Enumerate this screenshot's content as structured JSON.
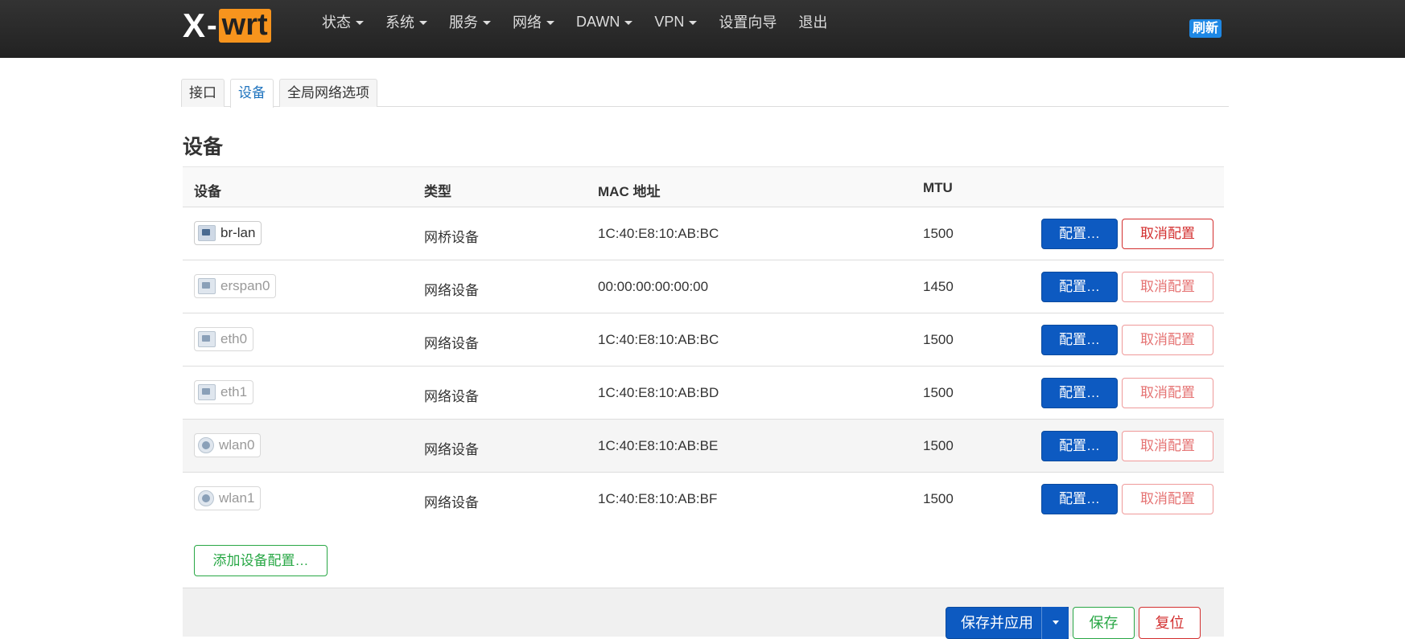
{
  "brand": {
    "x": "X",
    "dash": "-",
    "wrt": "wrt"
  },
  "nav": [
    {
      "label": "状态",
      "dropdown": true
    },
    {
      "label": "系统",
      "dropdown": true
    },
    {
      "label": "服务",
      "dropdown": true
    },
    {
      "label": "网络",
      "dropdown": true
    },
    {
      "label": "DAWN",
      "dropdown": true
    },
    {
      "label": "VPN",
      "dropdown": true
    },
    {
      "label": "设置向导",
      "dropdown": false
    },
    {
      "label": "退出",
      "dropdown": false
    }
  ],
  "refresh_label": "刷新",
  "tabs": [
    {
      "label": "接口",
      "active": false
    },
    {
      "label": "设备",
      "active": true
    },
    {
      "label": "全局网络选项",
      "active": false
    }
  ],
  "section": {
    "title": "设备",
    "columns": {
      "device": "设备",
      "type": "类型",
      "mac": "MAC 地址",
      "mtu": "MTU"
    }
  },
  "devices": [
    {
      "name": "br-lan",
      "icon": "bridge-icon",
      "type": "网桥设备",
      "mac": "1C:40:E8:10:AB:BC",
      "mtu": "1500",
      "configured": true
    },
    {
      "name": "erspan0",
      "icon": "ethernet-icon",
      "type": "网络设备",
      "mac": "00:00:00:00:00:00",
      "mtu": "1450",
      "configured": false
    },
    {
      "name": "eth0",
      "icon": "switch-icon",
      "type": "网络设备",
      "mac": "1C:40:E8:10:AB:BC",
      "mtu": "1500",
      "configured": false
    },
    {
      "name": "eth1",
      "icon": "ethernet-icon",
      "type": "网络设备",
      "mac": "1C:40:E8:10:AB:BD",
      "mtu": "1500",
      "configured": false
    },
    {
      "name": "wlan0",
      "icon": "wifi-icon",
      "type": "网络设备",
      "mac": "1C:40:E8:10:AB:BE",
      "mtu": "1500",
      "configured": false
    },
    {
      "name": "wlan1",
      "icon": "wifi-icon",
      "type": "网络设备",
      "mac": "1C:40:E8:10:AB:BF",
      "mtu": "1500",
      "configured": false
    }
  ],
  "buttons": {
    "configure": "配置…",
    "unconfigure": "取消配置",
    "add_device": "添加设备配置…",
    "save_apply": "保存并应用",
    "save": "保存",
    "reset": "复位"
  }
}
